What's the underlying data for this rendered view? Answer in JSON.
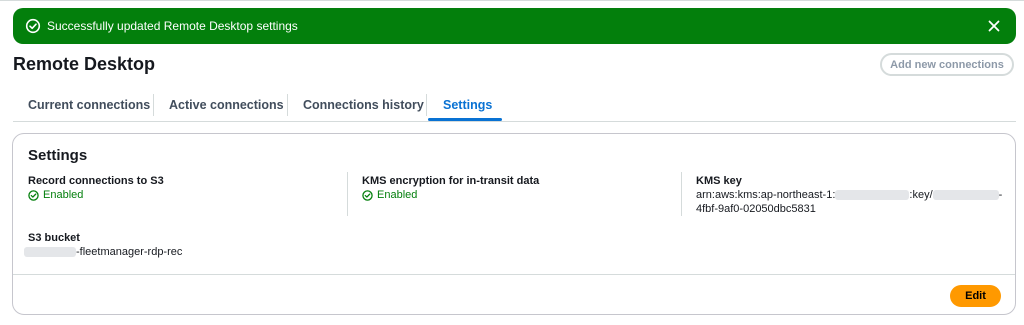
{
  "flash": {
    "message": "Successfully updated Remote Desktop settings",
    "icon": "check-circle-icon",
    "close_icon": "close-icon",
    "color": "#037f0c"
  },
  "header": {
    "title": "Remote Desktop",
    "add_button_label": "Add new connections"
  },
  "tabs": [
    {
      "label": "Current connections",
      "active": false
    },
    {
      "label": "Active connections",
      "active": false
    },
    {
      "label": "Connections history",
      "active": false
    },
    {
      "label": "Settings",
      "active": true
    }
  ],
  "settings": {
    "title": "Settings",
    "record_s3": {
      "label": "Record connections to S3",
      "status": "Enabled"
    },
    "kms_encryption": {
      "label": "KMS encryption for in-transit data",
      "status": "Enabled"
    },
    "kms_key": {
      "label": "KMS key",
      "line1_prefix": "arn:aws:kms:ap-northeast-1:",
      "line1_middle": ":key/",
      "line1_suffix": "-",
      "line2": "4fbf-9af0-02050dbc5831"
    },
    "s3_bucket": {
      "label": "S3 bucket",
      "value_suffix": "-fleetmanager-rdp-rec"
    },
    "edit_label": "Edit"
  },
  "colors": {
    "accent": "#0972d3",
    "success": "#037f0c",
    "primary_button": "#ff9900"
  }
}
